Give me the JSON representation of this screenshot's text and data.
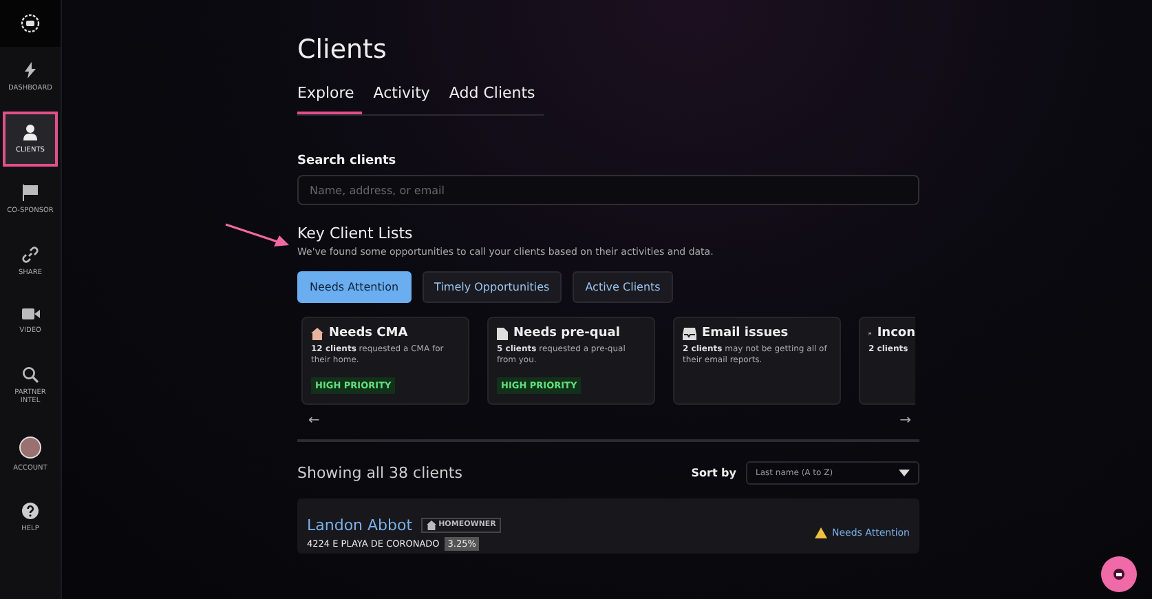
{
  "sidebar": {
    "items": [
      {
        "label": "DASHBOARD",
        "kind": "bolt",
        "selected": false
      },
      {
        "label": "CLIENTS",
        "kind": "person",
        "selected": true
      },
      {
        "label": "CO-SPONSOR",
        "kind": "flag",
        "selected": false
      },
      {
        "label": "SHARE",
        "kind": "link",
        "selected": false
      },
      {
        "label": "VIDEO",
        "kind": "camera",
        "selected": false
      },
      {
        "label": "PARTNER INTEL",
        "kind": "search",
        "selected": false
      },
      {
        "label": "ACCOUNT",
        "kind": "avatar",
        "selected": false
      },
      {
        "label": "HELP",
        "kind": "help",
        "selected": false
      }
    ]
  },
  "page": {
    "title": "Clients"
  },
  "tabs": [
    {
      "label": "Explore",
      "selected": true
    },
    {
      "label": "Activity",
      "selected": false
    },
    {
      "label": "Add Clients",
      "selected": false
    }
  ],
  "search": {
    "label": "Search clients",
    "placeholder": "Name, address, or email"
  },
  "key_lists": {
    "title": "Key Client Lists",
    "subtitle": "We've found some opportunities to call your clients based on their activities and data.",
    "filters": [
      {
        "label": "Needs Attention",
        "selected": true
      },
      {
        "label": "Timely Opportunities",
        "selected": false
      },
      {
        "label": "Active Clients",
        "selected": false
      }
    ],
    "cards": [
      {
        "kind": "house",
        "title": "Needs CMA",
        "body": "**12 clients** requested a CMA for their home.",
        "tag": "HIGH PRIORITY"
      },
      {
        "kind": "document",
        "title": "Needs pre-qual",
        "body": "**5 clients** requested a pre-qual from you.",
        "tag": "HIGH PRIORITY"
      },
      {
        "kind": "inbox",
        "title": "Email issues",
        "body": "**2 clients** may not be getting all of their email reports."
      },
      {
        "kind": "flag",
        "title": "Incon",
        "body": "**2 clients**"
      }
    ],
    "prev": "←",
    "next": "→"
  },
  "results": {
    "summary": "Showing all 38 clients",
    "sort_label": "Sort by",
    "sort_value": "Last name (A to Z)"
  },
  "clients": [
    {
      "name": "Landon Abbot",
      "tag": "HOMEOWNER",
      "address": "4224 E PLAYA DE CORONADO",
      "rate": "3.25%",
      "status": "Needs Attention"
    }
  ]
}
